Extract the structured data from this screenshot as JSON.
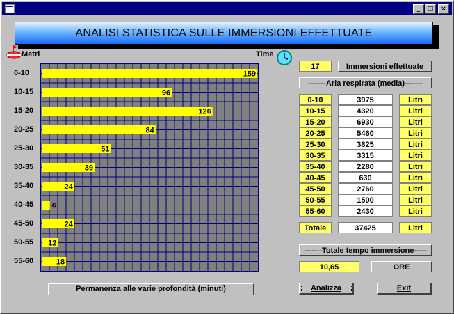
{
  "window": {
    "min_glyph": "_",
    "max_glyph": "□",
    "close_glyph": "×"
  },
  "banner": {
    "title": "ANALISI STATISTICA SULLE IMMERSIONI EFFETTUATE"
  },
  "chart_data": {
    "type": "bar",
    "orientation": "horizontal",
    "title": "",
    "ylabel": "Metri",
    "xlabel": "Time",
    "categories": [
      "0-10",
      "10-15",
      "15-20",
      "20-25",
      "25-30",
      "30-35",
      "35-40",
      "40-45",
      "45-50",
      "50-55",
      "55-60"
    ],
    "values": [
      159,
      96,
      126,
      84,
      51,
      39,
      24,
      6,
      24,
      12,
      18
    ],
    "xlim": [
      0,
      160
    ],
    "grid": true,
    "bar_color": "#ffff00",
    "plot_background": "#808080",
    "grid_color": "#000080",
    "caption": "Permanenza alle varie profondità (minuti)"
  },
  "stats": {
    "dives_count": "17",
    "dives_label": "Immersioni effettuate",
    "air_header": "-------Aria respirata (media)-------",
    "unit": "Litri",
    "rows": [
      {
        "range": "0-10",
        "value": "3975"
      },
      {
        "range": "10-15",
        "value": "4320"
      },
      {
        "range": "15-20",
        "value": "6930"
      },
      {
        "range": "20-25",
        "value": "5460"
      },
      {
        "range": "25-30",
        "value": "3825"
      },
      {
        "range": "30-35",
        "value": "3315"
      },
      {
        "range": "35-40",
        "value": "2280"
      },
      {
        "range": "40-45",
        "value": "630"
      },
      {
        "range": "45-50",
        "value": "2760"
      },
      {
        "range": "50-55",
        "value": "1500"
      },
      {
        "range": "55-60",
        "value": "2430"
      }
    ],
    "total_label": "Totale",
    "total_value": "37425",
    "time_header": "-------Totale tempo immersione-----",
    "time_value": "10,65",
    "time_unit": "ORE"
  },
  "buttons": {
    "analyze": "Analizza",
    "exit": "Exit"
  }
}
